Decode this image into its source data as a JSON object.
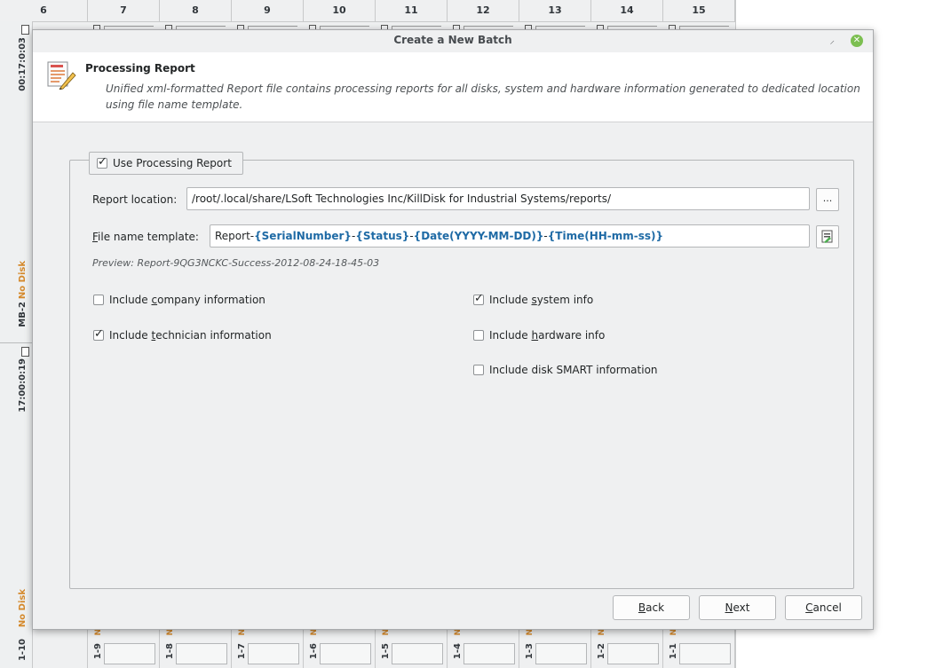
{
  "grid": {
    "columns": [
      "6",
      "7",
      "8",
      "9",
      "10",
      "11",
      "12",
      "13",
      "14",
      "15"
    ],
    "left_strip": {
      "time1": "00:17:0:03",
      "status1": "No Disk",
      "slot1": "MB-2",
      "time2": "17:00:0:19",
      "status2": "No Disk",
      "slot2": "1-10"
    },
    "bottom_slots": [
      {
        "status": "N",
        "name": "1-9"
      },
      {
        "status": "N",
        "name": "1-8"
      },
      {
        "status": "N",
        "name": "1-7"
      },
      {
        "status": "N",
        "name": "1-6"
      },
      {
        "status": "N",
        "name": "1-5"
      },
      {
        "status": "N",
        "name": "1-4"
      },
      {
        "status": "N",
        "name": "1-3"
      },
      {
        "status": "N",
        "name": "1-2"
      },
      {
        "status": "N",
        "name": "1-1"
      }
    ]
  },
  "dialog": {
    "title": "Create a New Batch",
    "pin_icon": "pin-icon",
    "close_icon": "close-icon",
    "header": {
      "title": "Processing Report",
      "description": "Unified xml-formatted Report file contains processing reports for all disks, system and hardware information generated to dedicated location using file name template."
    },
    "use_processing_report": {
      "label": "Use Processing Report",
      "checked": true
    },
    "report_location": {
      "label": "Report location:",
      "value": "/root/.local/share/LSoft Technologies Inc/KillDisk for Industrial Systems/reports/",
      "browse_label": "..."
    },
    "file_name_template": {
      "label_first": "F",
      "label_rest": "ile name template:",
      "prefix": "Report",
      "tokens": [
        "{SerialNumber}",
        "{Status}",
        "{Date(YYYY-MM-DD)}",
        "{Time(HH-mm-ss)}"
      ],
      "separator": "-"
    },
    "preview": "Preview: Report-9QG3NCKC-Success-2012-08-24-18-45-03",
    "options_left": [
      {
        "pre": "Include ",
        "acc": "c",
        "post": "ompany information",
        "checked": false
      },
      {
        "pre": "Include ",
        "acc": "t",
        "post": "echnician information",
        "checked": true
      }
    ],
    "options_right": [
      {
        "pre": "Include ",
        "acc": "s",
        "post": "ystem info",
        "checked": true
      },
      {
        "pre": "Include ",
        "acc": "h",
        "post": "ardware info",
        "checked": false
      },
      {
        "pre": "Include disk SMART information",
        "acc": "",
        "post": "",
        "checked": false
      }
    ],
    "buttons": {
      "back": {
        "acc": "B",
        "rest": "ack"
      },
      "next": {
        "acc": "N",
        "rest": "ext"
      },
      "cancel": {
        "acc": "C",
        "rest": "ancel"
      }
    },
    "colors": {
      "token": "#1e6aa5",
      "status_orange": "#d4882a",
      "close_green": "#7cbf51"
    }
  }
}
